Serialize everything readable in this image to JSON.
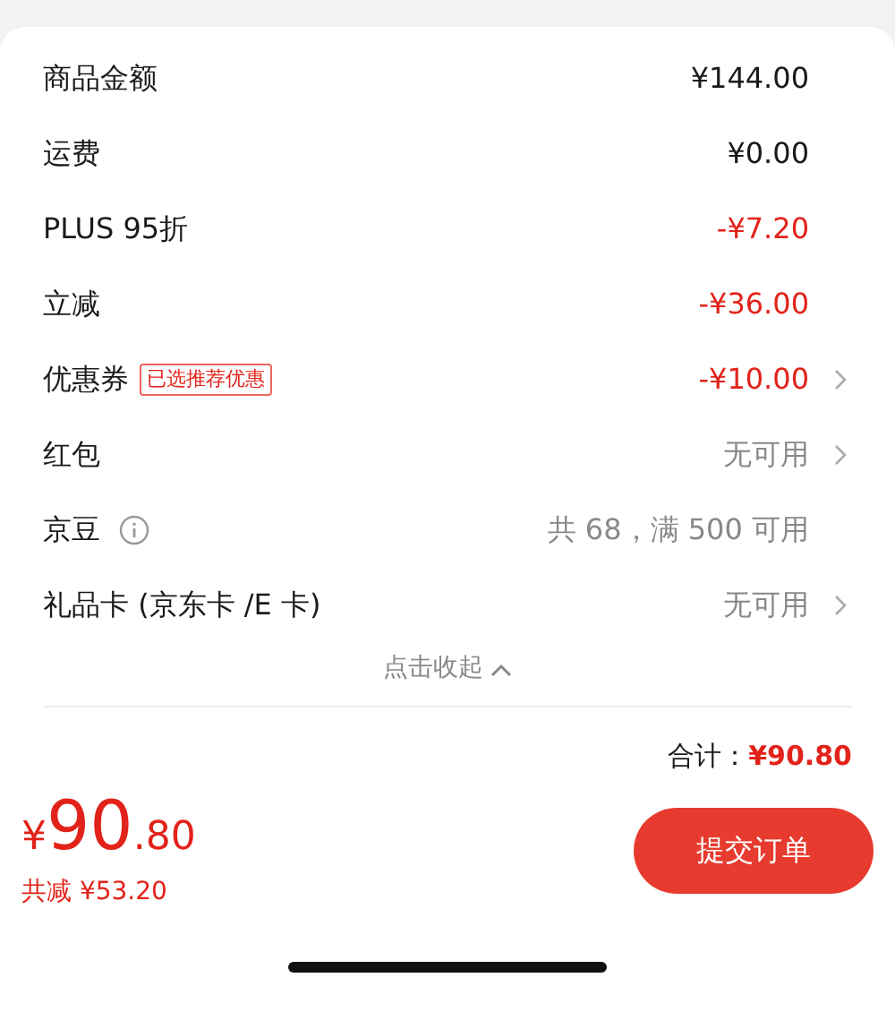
{
  "rows": [
    {
      "label": "商品金额",
      "value": "¥144.00",
      "kind": "amount",
      "has_arrow": false
    },
    {
      "label": "运费",
      "value": "¥0.00",
      "kind": "amount",
      "has_arrow": false
    },
    {
      "label": "PLUS 95折",
      "value": "-¥7.20",
      "kind": "discount",
      "has_arrow": false
    },
    {
      "label": "立减",
      "value": "-¥36.00",
      "kind": "discount",
      "has_arrow": false
    },
    {
      "label": "优惠券",
      "tag": "已选推荐优惠",
      "value": "-¥10.00",
      "kind": "discount",
      "has_arrow": true
    },
    {
      "label": "红包",
      "value": "无可用",
      "kind": "muted",
      "has_arrow": true
    },
    {
      "label": "京豆",
      "has_info": true,
      "value": "共 68，满 500 可用",
      "kind": "muted",
      "has_arrow": false
    },
    {
      "label": "礼品卡 (京东卡 /E 卡)",
      "value": "无可用",
      "kind": "muted",
      "has_arrow": true
    }
  ],
  "collapse": {
    "label": "点击收起"
  },
  "total": {
    "label": "合计：",
    "value": "¥90.80"
  },
  "footer": {
    "price_symbol": "¥",
    "price_int": "90",
    "price_dec": ".80",
    "saved": "共减 ¥53.20",
    "submit": "提交订单"
  }
}
